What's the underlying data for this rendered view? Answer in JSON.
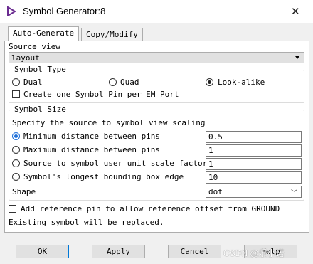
{
  "window": {
    "title": "Symbol Generator:8",
    "close_glyph": "✕"
  },
  "tabs": [
    {
      "label": "Auto-Generate"
    },
    {
      "label": "Copy/Modify"
    }
  ],
  "source_view": {
    "label": "Source view",
    "value": "layout"
  },
  "symbol_type": {
    "legend": "Symbol Type",
    "options": [
      {
        "label": "Dual",
        "selected": false
      },
      {
        "label": "Quad",
        "selected": false
      },
      {
        "label": "Look-alike",
        "selected": true
      }
    ],
    "checkbox_label": "Create one Symbol Pin per EM Port"
  },
  "symbol_size": {
    "legend": "Symbol Size",
    "description": "Specify the source to symbol view scaling",
    "options": [
      {
        "label": "Minimum distance between pins",
        "value": "0.5",
        "selected": true
      },
      {
        "label": "Maximum distance between pins",
        "value": "1",
        "selected": false
      },
      {
        "label": "Source to symbol user unit scale factor",
        "value": "1",
        "selected": false
      },
      {
        "label": "Symbol's longest bounding box edge",
        "value": "10",
        "selected": false
      }
    ],
    "shape_label": "Shape",
    "shape_value": "dot"
  },
  "reference_pin": {
    "label": "Add reference pin to allow reference offset from GROUND"
  },
  "notice": "Existing symbol will be replaced.",
  "buttons": {
    "ok": "OK",
    "apply": "Apply",
    "cancel": "Cancel",
    "help": "Help"
  },
  "watermark": "CSDN @乐小诺",
  "colors": {
    "accent": "#0078d7",
    "title_icon": "#6b2c91"
  },
  "icons": {
    "app": "symbol-triangle-icon",
    "dropdown": "chevron-down-icon"
  }
}
